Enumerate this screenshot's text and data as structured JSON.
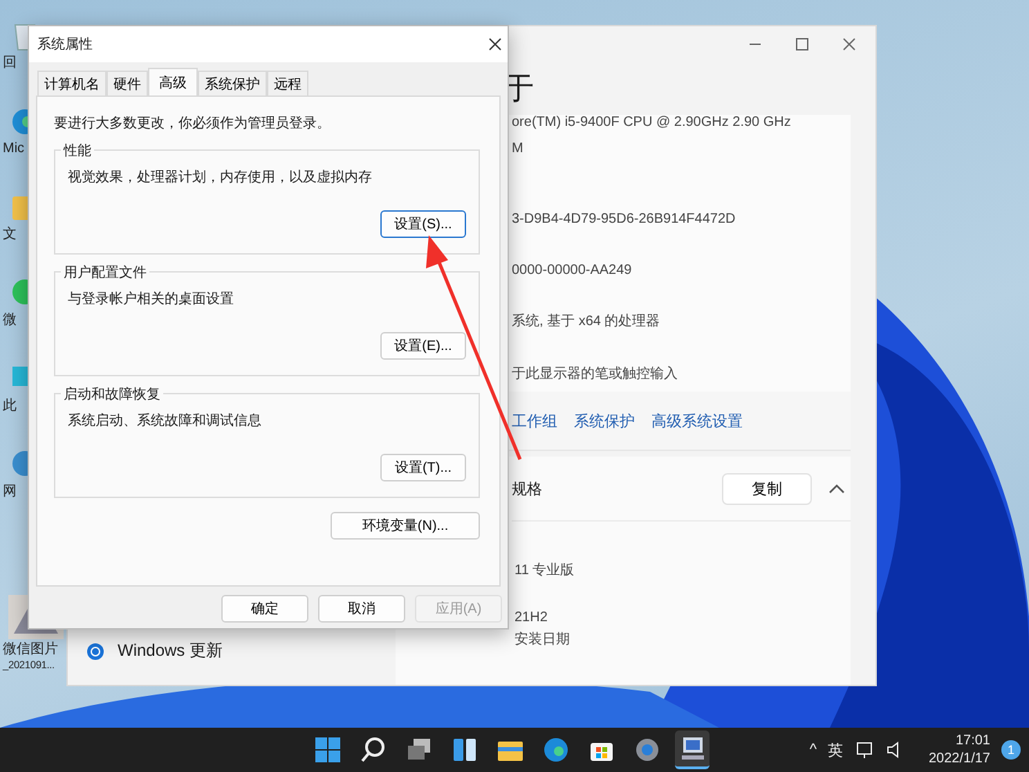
{
  "desktop_icons": [
    {
      "kind": "bin",
      "label": "回"
    },
    {
      "kind": "edge",
      "label": "Mic"
    },
    {
      "kind": "folder",
      "label": "文"
    },
    {
      "kind": "chat",
      "label": "微"
    },
    {
      "kind": "pc",
      "label": "此"
    },
    {
      "kind": "network",
      "label": "网"
    },
    {
      "kind": "photo",
      "label": "微信图片",
      "sublabel": "_2021091..."
    }
  ],
  "settings_window": {
    "heading": "于",
    "info_lines": [
      "ore(TM) i5-9400F CPU @ 2.90GHz   2.90 GHz",
      "M",
      "3-D9B4-4D79-95D6-26B914F4472D",
      "0000-00000-AA249",
      "系统, 基于 x64 的处理器",
      "于此显示器的笔或触控输入"
    ],
    "links": [
      "工作组",
      "系统保护",
      "高级系统设置"
    ],
    "section": {
      "title": "规格",
      "button": "复制",
      "expanded": true
    },
    "spec_lines": [
      "11 专业版",
      "21H2",
      "安装日期"
    ],
    "sidebar_item": "Windows 更新"
  },
  "dialog": {
    "title": "系统属性",
    "tabs": [
      {
        "label": "计算机名",
        "selected": false
      },
      {
        "label": "硬件",
        "selected": false
      },
      {
        "label": "高级",
        "selected": true
      },
      {
        "label": "系统保护",
        "selected": false
      },
      {
        "label": "远程",
        "selected": false
      }
    ],
    "notice": "要进行大多数更改，你必须作为管理员登录。",
    "groups": [
      {
        "title": "性能",
        "description": "视觉效果，处理器计划，内存使用，以及虚拟内存",
        "button": "设置(S)...",
        "focused": true
      },
      {
        "title": "用户配置文件",
        "description": "与登录帐户相关的桌面设置",
        "button": "设置(E)...",
        "focused": false
      },
      {
        "title": "启动和故障恢复",
        "description": "系统启动、系统故障和调试信息",
        "button": "设置(T)...",
        "focused": false
      }
    ],
    "env_button": "环境变量(N)...",
    "buttons": [
      {
        "label": "确定",
        "disabled": false
      },
      {
        "label": "取消",
        "disabled": false
      },
      {
        "label": "应用(A)",
        "disabled": true
      }
    ]
  },
  "taskbar": {
    "apps": [
      {
        "kind": "start",
        "active": false
      },
      {
        "kind": "search",
        "active": false
      },
      {
        "kind": "taskview",
        "active": false
      },
      {
        "kind": "widgets",
        "active": false
      },
      {
        "kind": "explorer",
        "active": false
      },
      {
        "kind": "edge",
        "active": false
      },
      {
        "kind": "store",
        "active": false
      },
      {
        "kind": "settings",
        "active": false
      },
      {
        "kind": "system",
        "active": true
      }
    ],
    "tray": {
      "chevron": "^",
      "ime": "英",
      "time": "17:01",
      "date": "2022/1/17",
      "notifications": "1"
    }
  }
}
